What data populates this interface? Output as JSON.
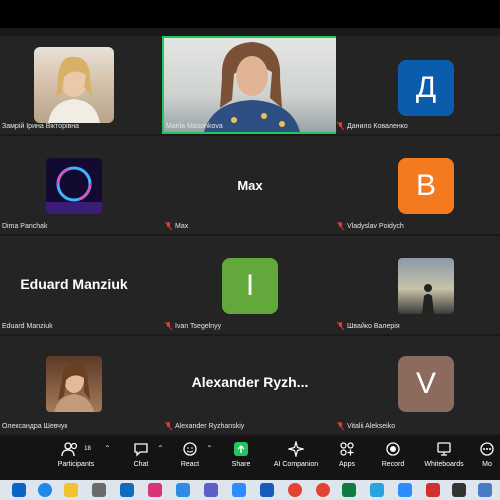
{
  "participants": [
    {
      "id": "zamrii",
      "name": "Замрій Ірина Вікторівна",
      "muted": false,
      "kind": "photo",
      "color": "#d9cab8"
    },
    {
      "id": "mariia",
      "name": "Mariia Masonkova",
      "muted": false,
      "kind": "video",
      "active": true
    },
    {
      "id": "danylo",
      "name": "Данило Коваленко",
      "muted": true,
      "kind": "letter",
      "letter": "Д",
      "color": "#0b5cad"
    },
    {
      "id": "dima",
      "name": "Dima Panchak",
      "muted": false,
      "kind": "photo",
      "color": "#1a0b3d"
    },
    {
      "id": "max",
      "name": "Max",
      "muted": true,
      "kind": "text",
      "display": "Max"
    },
    {
      "id": "vladyslav",
      "name": "Vladyslav Poidych",
      "muted": true,
      "kind": "letter",
      "letter": "B",
      "color": "#f47a20"
    },
    {
      "id": "eduard",
      "name": "Eduard Manziuk",
      "muted": false,
      "kind": "text",
      "display": "Eduard Manziuk"
    },
    {
      "id": "ivan",
      "name": "Ivan Tsegelnyy",
      "muted": true,
      "kind": "letter",
      "letter": "I",
      "color": "#63a83a"
    },
    {
      "id": "shvaiko",
      "name": "Швайко Валерія",
      "muted": true,
      "kind": "photo",
      "color": "#4a5a6a"
    },
    {
      "id": "oleksandra",
      "name": "Олександра Шевчук",
      "muted": false,
      "kind": "photo",
      "color": "#8a6a50"
    },
    {
      "id": "alexander",
      "name": "Alexander Ryzhanskiy",
      "muted": true,
      "kind": "text",
      "display": "Alexander  Ryzh..."
    },
    {
      "id": "vitalii",
      "name": "Vitalii Alekseiko",
      "muted": true,
      "kind": "letter",
      "letter": "V",
      "color": "#8c6a5e"
    }
  ],
  "toolbar": {
    "participants_label": "Participants",
    "participants_count": "18",
    "chat_label": "Chat",
    "react_label": "React",
    "share_label": "Share",
    "ai_label": "AI Companion",
    "apps_label": "Apps",
    "record_label": "Record",
    "whiteboards_label": "Whiteboards",
    "more_label": "Mo"
  },
  "colors": {
    "share_green": "#22c55e",
    "muted_red": "#e53935",
    "active_border": "#22c55e"
  }
}
